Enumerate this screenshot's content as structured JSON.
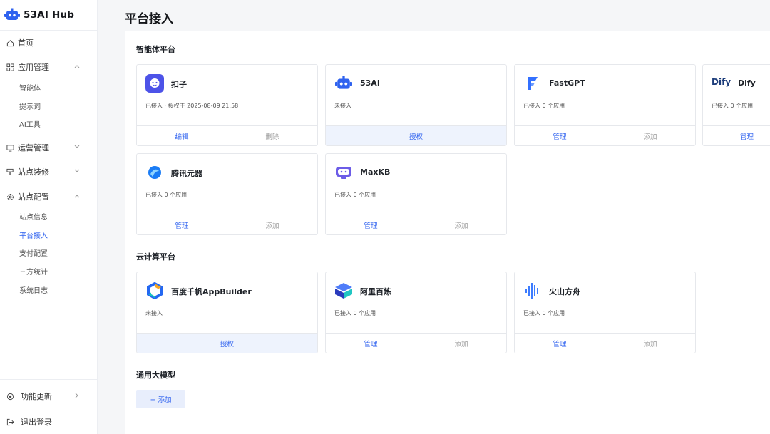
{
  "app": {
    "title": "53AI Hub"
  },
  "sidebar": {
    "home": "首页",
    "app_manage": "应用管理",
    "app_sub": [
      "智能体",
      "提示词",
      "AI工具"
    ],
    "ops_manage": "运营管理",
    "site_decor": "站点装修",
    "site_config": "站点配置",
    "config_sub": [
      "站点信息",
      "平台接入",
      "支付配置",
      "三方统计",
      "系统日志"
    ],
    "update": "功能更新",
    "logout": "退出登录"
  },
  "page": {
    "title": "平台接入"
  },
  "sections": {
    "agent": "智能体平台",
    "cloud": "云计算平台",
    "llm": "通用大模型"
  },
  "cards": {
    "kouzi": {
      "name": "扣子",
      "status": "已接入 · 授权于 2025-08-09 21:58",
      "a1": "编辑",
      "a2": "删除"
    },
    "ai53": {
      "name": "53AI",
      "status": "未接入",
      "a1": "授权"
    },
    "fastgpt": {
      "name": "FastGPT",
      "status": "已接入 0 个应用",
      "a1": "管理",
      "a2": "添加"
    },
    "dify": {
      "logo": "Dify",
      "name": "Dify",
      "status": "已接入 0 个应用",
      "a1": "管理"
    },
    "tencent": {
      "name": "腾讯元器",
      "status": "已接入 0 个应用",
      "a1": "管理",
      "a2": "添加"
    },
    "maxkb": {
      "name": "MaxKB",
      "status": "已接入 0 个应用",
      "a1": "管理",
      "a2": "添加"
    },
    "baidu": {
      "name": "百度千帆AppBuilder",
      "status": "未接入",
      "a1": "授权"
    },
    "aliyun": {
      "name": "阿里百炼",
      "status": "已接入 0 个应用",
      "a1": "管理",
      "a2": "添加"
    },
    "volc": {
      "name": "火山方舟",
      "status": "已接入 0 个应用",
      "a1": "管理",
      "a2": "添加"
    }
  },
  "llm": {
    "add_label": "+ 添加"
  },
  "colors": {
    "accent": "#2f62ef",
    "bg": "#f5f6f8",
    "border": "#e6e8ec"
  }
}
